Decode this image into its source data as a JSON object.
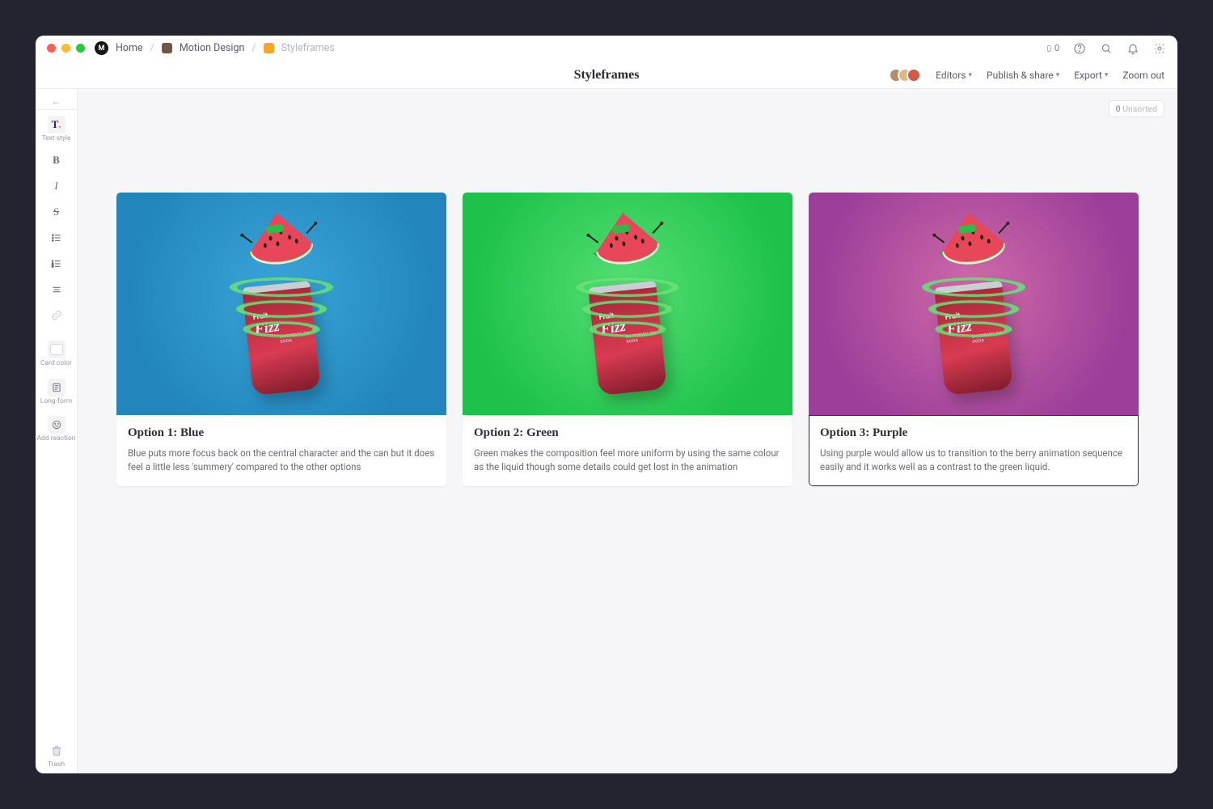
{
  "breadcrumbs": {
    "home": "Home",
    "project": "Motion Design",
    "page": "Styleframes"
  },
  "titlebar_icons": {
    "phone_count": "0"
  },
  "doc_title": "Styleframes",
  "secondary": {
    "editors": "Editors",
    "publish": "Publish & share",
    "export": "Export",
    "zoom": "Zoom out"
  },
  "unsorted": {
    "count": "0",
    "label": "Unsorted"
  },
  "sidebar": {
    "text_style": "Text style",
    "card_color": "Card color",
    "long_form": "Long-form",
    "add_reaction": "Add reaction",
    "trash": "Trash"
  },
  "cards": [
    {
      "title": "Option 1: Blue",
      "desc": "Blue puts more focus back on the central character and the can but it does feel a little less 'summery' compared to the other options"
    },
    {
      "title": "Option 2: Green",
      "desc": "Green makes the composition feel more uniform by using the same colour as the liquid though some details could get lost in the animation"
    },
    {
      "title": "Option 3: Purple",
      "desc": "Using purple would allow us to transition to the berry animation sequence easily and it works well as a contrast to the green liquid."
    }
  ],
  "can": {
    "brand_line1": "Fruit",
    "brand_line2": "Fizz",
    "sub": "WATERMELON SODA"
  }
}
